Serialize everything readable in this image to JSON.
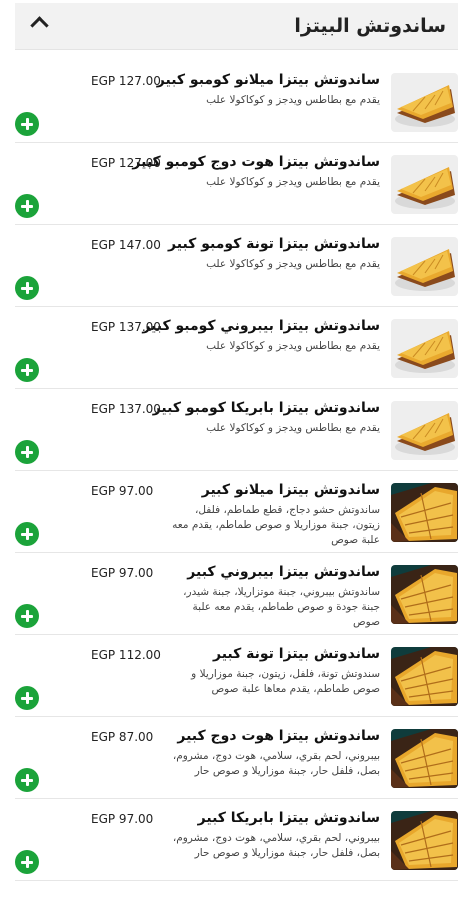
{
  "section": {
    "title": "ساندوتش البيتزا",
    "collapse_icon": "chevron-up-icon"
  },
  "items": [
    {
      "name": "ساندوتش بيتزا ميلانو كومبو كبير",
      "description": "يقدم مع بطاطس ويدجز و كوكاكولا علب",
      "price": "EGP 127.00",
      "image": "pizza-sandwich-combo",
      "background": "#eeeeee"
    },
    {
      "name": "ساندوتش بيتزا هوت دوج كومبو كبير",
      "description": "يقدم مع بطاطس ويدجز و كوكاكولا علب",
      "price": "EGP 127.00",
      "image": "pizza-sandwich-combo",
      "background": "#eeeeee"
    },
    {
      "name": "ساندوتش بيتزا تونة كومبو كبير",
      "description": "يقدم مع بطاطس ويدجز و كوكاكولا علب",
      "price": "EGP 147.00",
      "image": "pizza-sandwich-combo",
      "background": "#eeeeee"
    },
    {
      "name": "ساندوتش بيتزا بيبروني كومبو كبير",
      "description": "يقدم مع بطاطس ويدجز و كوكاكولا علب",
      "price": "EGP 137.00",
      "image": "pizza-sandwich-combo",
      "background": "#eeeeee"
    },
    {
      "name": "ساندوتش بيتزا بابريكا كومبو كبير",
      "description": "يقدم مع بطاطس ويدجز و كوكاكولا علب",
      "price": "EGP 137.00",
      "image": "pizza-sandwich-combo",
      "background": "#eeeeee"
    },
    {
      "name": "ساندوتش بيتزا ميلانو كبير",
      "description": "ساندوتش حشو دجاج، قطع طماطم، فلفل، زيتون، جبنة موزاريلا و صوص طماطم، يقدم معه علبة صوص",
      "price": "EGP 97.00",
      "image": "pizza-sandwich",
      "background": "#0f3c3c"
    },
    {
      "name": "ساندوتش بيتزا بيبروني كبير",
      "description": "ساندوتش بيبروني، جبنة موتزاريلا، جبنة شيدر، جبنة جودة و صوص طماطم، يقدم معه علبة صوص",
      "price": "EGP 97.00",
      "image": "pizza-sandwich",
      "background": "#0f3c3c"
    },
    {
      "name": "ساندوتش بيتزا تونة كبير",
      "description": "سندوتش تونة، فلفل، زيتون، جبنة موزاريلا و صوص طماطم، يقدم معاها علبة صوص",
      "price": "EGP 112.00",
      "image": "pizza-sandwich",
      "background": "#0f3c3c"
    },
    {
      "name": "ساندوتش بيتزا هوت دوج كبير",
      "description": "بيبروني، لحم بقري، سلامي، هوت دوج، مشروم، بصل، فلفل حار، جبنة موزاريلا و صوص حار",
      "price": "EGP 87.00",
      "image": "pizza-sandwich",
      "background": "#0f3c3c"
    },
    {
      "name": "ساندوتش بيتزا بابريكا كبير",
      "description": "بيبروني، لحم بقري، سلامي، هوت دوج، مشروم، بصل، فلفل حار، جبنة موزاريلا و صوص حار",
      "price": "EGP 97.00",
      "image": "pizza-sandwich",
      "background": "#0f3c3c"
    }
  ],
  "add_button": {
    "icon": "plus-icon",
    "color": "#1ba33a"
  }
}
